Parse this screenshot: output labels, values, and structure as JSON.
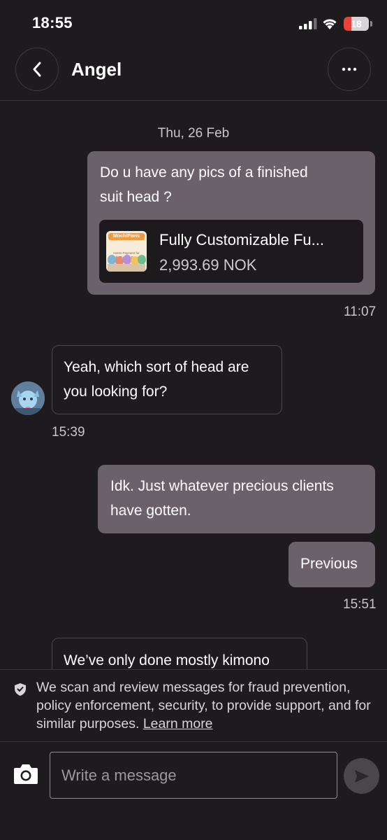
{
  "status_bar": {
    "time": "18:55",
    "battery": "18"
  },
  "header": {
    "title": "Angel"
  },
  "conversation": {
    "date_label": "Thu, 26 Feb",
    "messages": [
      {
        "direction": "outgoing",
        "text_lines": [
          "Do u have any pics of a finished",
          "suit head ?"
        ],
        "product": {
          "title": "Fully Customizable Fu...",
          "price": "2,993.69 NOK",
          "thumb_brand": "MochiPaws",
          "thumb_caption_1": "Heres Payment for",
          "thumb_caption_2": "Fully Custom Fursuit"
        },
        "time": "11:07"
      },
      {
        "direction": "incoming",
        "text_lines": [
          "Yeah, which sort of head are",
          "you looking for?"
        ],
        "time": "15:39"
      },
      {
        "direction": "outgoing",
        "text_lines": [
          "Idk. Just whatever precious clients",
          "have gotten."
        ]
      },
      {
        "direction": "outgoing",
        "text_lines": [
          "Previous"
        ],
        "time": "15:51"
      },
      {
        "direction": "incoming",
        "text_lines": [
          "We’ve only done mostly kimono"
        ]
      }
    ]
  },
  "notice": {
    "text": "We scan and review messages for fraud prevention, policy enforcement, security, to provide support, and for similar purposes.",
    "link": "Learn more"
  },
  "composer": {
    "placeholder": "Write a message"
  },
  "colors": {
    "background": "#1d1b1e",
    "outgoing_bubble": "#6b616b",
    "battery_low": "#e5443b"
  }
}
